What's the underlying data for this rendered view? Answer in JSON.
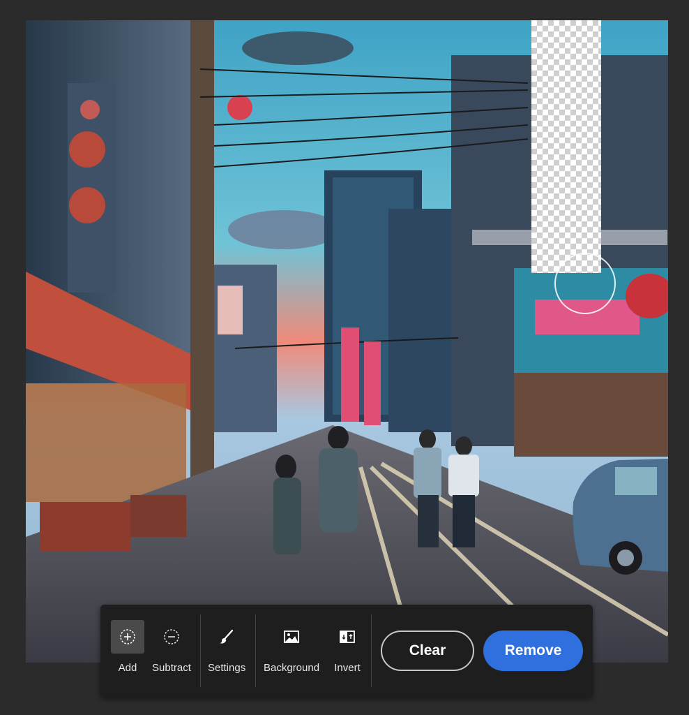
{
  "toolbar": {
    "tools": [
      {
        "label": "Add",
        "icon": "add-circle-icon",
        "active": true
      },
      {
        "label": "Subtract",
        "icon": "subtract-circle-icon",
        "active": false
      },
      {
        "label": "Settings",
        "icon": "brush-icon",
        "active": false
      },
      {
        "label": "Background",
        "icon": "image-icon",
        "active": false
      },
      {
        "label": "Invert",
        "icon": "invert-icon",
        "active": false
      }
    ],
    "clear_label": "Clear",
    "remove_label": "Remove"
  },
  "colors": {
    "accent": "#2f6fde",
    "toolbar_bg": "#1e1e1e",
    "app_bg": "#2b2b2b"
  }
}
